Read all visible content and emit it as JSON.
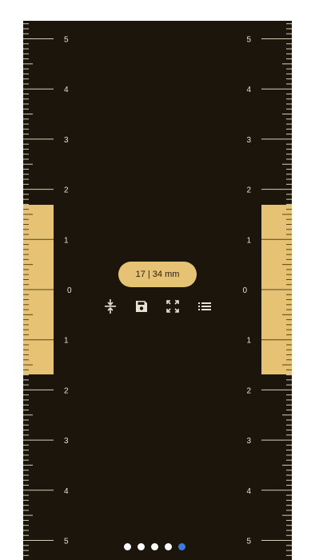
{
  "ruler": {
    "labels_top": [
      "5",
      "4",
      "3",
      "2",
      "1"
    ],
    "label_center": "0",
    "labels_bottom": [
      "1",
      "2",
      "3",
      "4",
      "5"
    ],
    "tick_color": "#d9cfb8",
    "highlight_color": "#e6c374",
    "background_color": "#1b150c"
  },
  "measurement": {
    "readout": "17 | 34 mm"
  },
  "toolbar": {
    "icons": [
      "compress-icon",
      "save-icon",
      "fullscreen-icon",
      "list-icon"
    ]
  },
  "pager": {
    "page_count": 5,
    "active_page": 5,
    "active_color": "#3a7be0"
  }
}
